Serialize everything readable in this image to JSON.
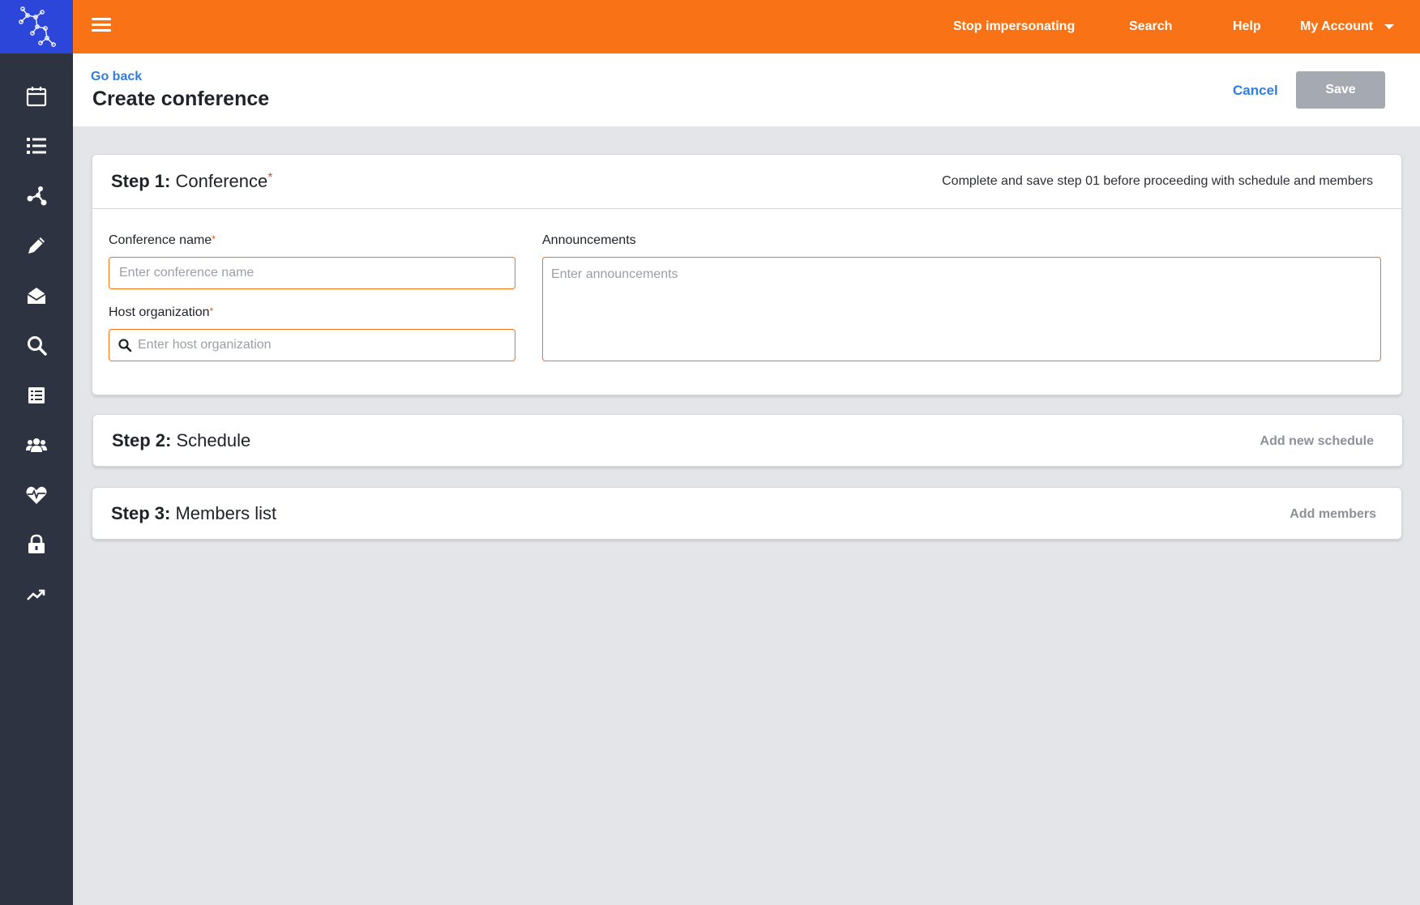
{
  "topbar": {
    "nav": [
      "Stop impersonating",
      "Search",
      "Help"
    ],
    "account": "My Account"
  },
  "header": {
    "go_back": "Go back",
    "title": "Create conference",
    "cancel": "Cancel",
    "save": "Save"
  },
  "sidebar": {
    "icons": [
      "calendar-icon",
      "list-icon",
      "network-icon",
      "pencil-icon",
      "envelope-open-icon",
      "search-icon",
      "document-list-icon",
      "users-icon",
      "heartbeat-icon",
      "lock-icon",
      "trending-icon"
    ]
  },
  "step1": {
    "step_label": "Step 1:",
    "title": "Conference",
    "required_mark": "*",
    "note": "Complete and save step 01 before proceeding with schedule and members",
    "conference_name_label": "Conference name",
    "conference_name_placeholder": "Enter conference name",
    "host_org_label": "Host organization",
    "host_org_placeholder": "Enter host organization",
    "announcements_label": "Announcements",
    "announcements_placeholder": "Enter announcements"
  },
  "step2": {
    "step_label": "Step 2:",
    "title": "Schedule",
    "action": "Add new schedule"
  },
  "step3": {
    "step_label": "Step 3:",
    "title": "Members list",
    "action": "Add members"
  },
  "colors": {
    "accent": "#f97316",
    "logo_bg": "#2c46d9",
    "sidebar_bg": "#2d3340",
    "link": "#2f7de1"
  }
}
